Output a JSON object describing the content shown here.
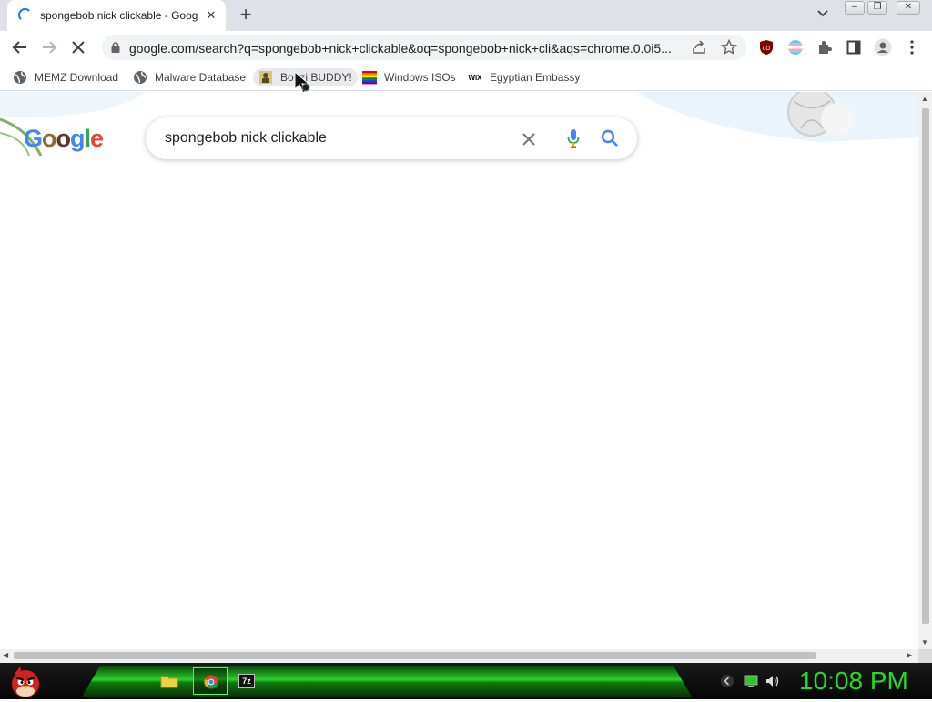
{
  "browser": {
    "tab": {
      "title": "spongebob nick clickable - Goog"
    },
    "url": "google.com/search?q=spongebob+nick+clickable&oq=spongebob+nick+cli&aqs=chrome.0.0i5..."
  },
  "bookmarks": [
    {
      "label": "MEMZ Download"
    },
    {
      "label": "Malware Database"
    },
    {
      "label": "Bonzi BUDDY!"
    },
    {
      "label": "Windows ISOs"
    },
    {
      "label": "Egyptian Embassy"
    }
  ],
  "google": {
    "logo_text": "Google",
    "search_query": "spongebob nick clickable"
  },
  "taskbar": {
    "clock": "10:08 PM"
  },
  "colors": {
    "accent_blue": "#1a73e8",
    "taskbar_green": "#22dd22",
    "clock_green": "#22dd22"
  }
}
